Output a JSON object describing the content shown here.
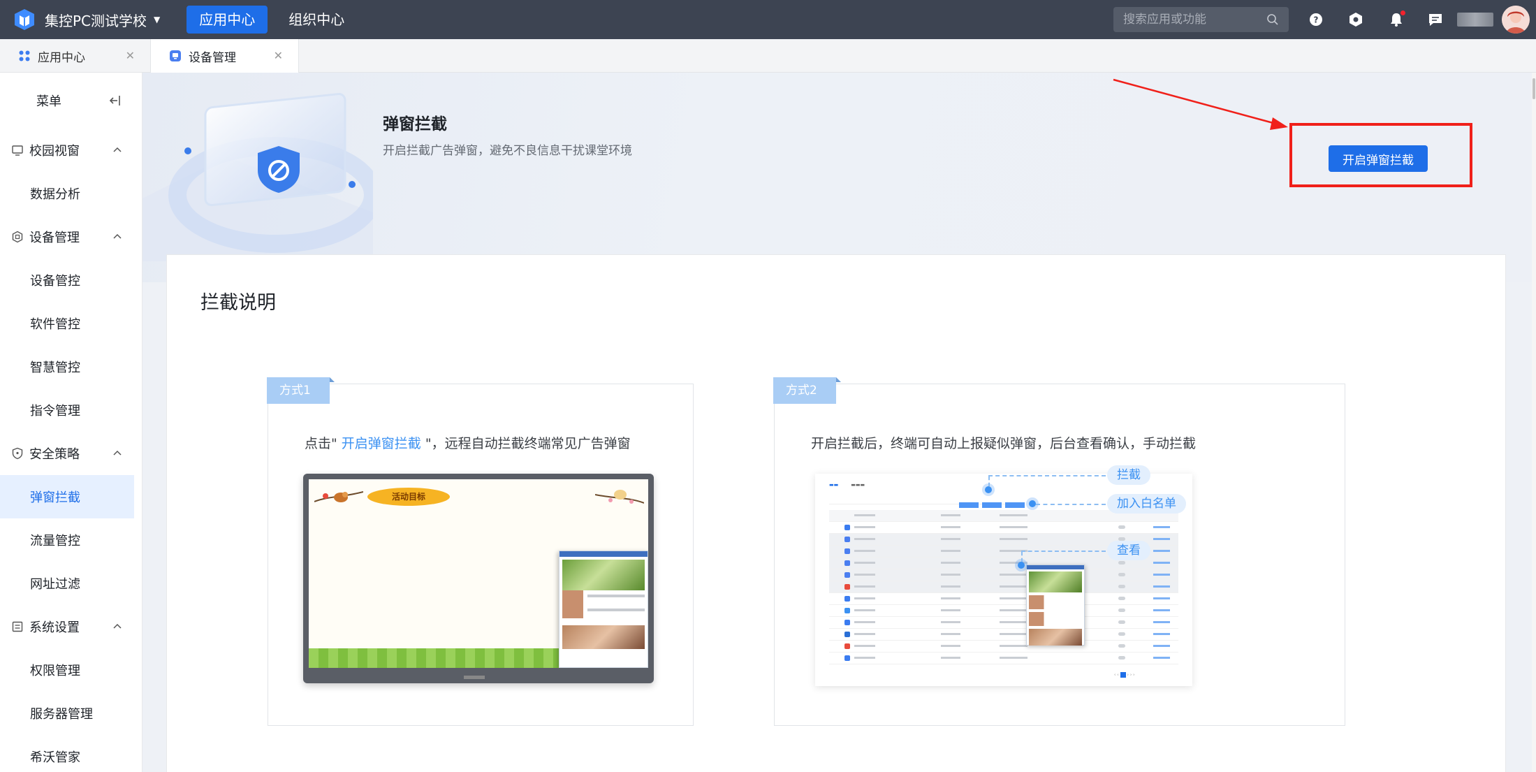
{
  "header": {
    "school_name": "集控PC测试学校",
    "nav": [
      {
        "label": "应用中心",
        "active": true
      },
      {
        "label": "组织中心",
        "active": false
      }
    ],
    "search_placeholder": "搜索应用或功能"
  },
  "tabs": [
    {
      "label": "应用中心",
      "active": false
    },
    {
      "label": "设备管理",
      "active": true
    }
  ],
  "sidebar": {
    "title": "菜单",
    "groups": [
      {
        "label": "校园视窗",
        "items": [
          "数据分析"
        ]
      },
      {
        "label": "设备管理",
        "items": [
          "设备管控",
          "软件管控",
          "智慧管控",
          "指令管理"
        ]
      },
      {
        "label": "安全策略",
        "items": [
          "弹窗拦截",
          "流量管控",
          "网址过滤"
        ]
      },
      {
        "label": "系统设置",
        "items": [
          "权限管理",
          "服务器管理",
          "希沃管家"
        ]
      }
    ],
    "selected": "弹窗拦截"
  },
  "banner": {
    "title": "弹窗拦截",
    "description": "开启拦截广告弹窗，避免不良信息干扰课堂环境",
    "button_label": "开启弹窗拦截"
  },
  "card": {
    "title": "拦截说明",
    "way1": {
      "tag": "方式1",
      "text_before": "点击\" ",
      "link": "开启弹窗拦截",
      "text_after": " \"，远程自动拦截终端常见广告弹窗",
      "screen_banner": "活动目标"
    },
    "way2": {
      "tag": "方式2",
      "text": "开启拦截后，终端可自动上报疑似弹窗，后台查看确认，手动拦截",
      "callouts": [
        "拦截",
        "加入白名单",
        "查看"
      ]
    }
  },
  "colors": {
    "topbar": "#3d4452",
    "accent": "#1e6ee8",
    "link": "#3b91f2",
    "highlight": "#f0201a",
    "selected_bg": "#e6f0ff"
  }
}
